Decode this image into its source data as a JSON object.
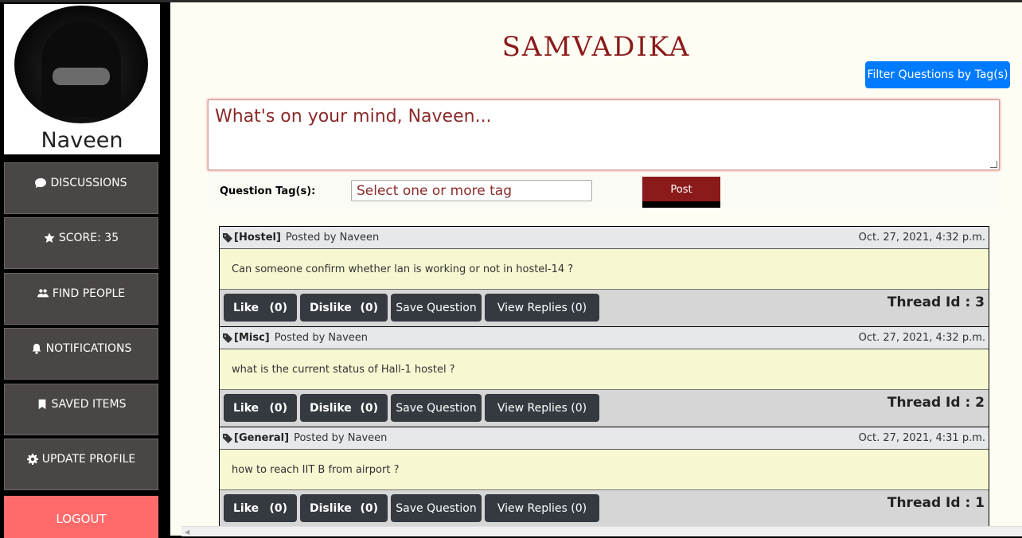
{
  "app": {
    "title": "SAMVADIKA"
  },
  "user": {
    "name": "Naveen"
  },
  "sidebar": {
    "items": [
      {
        "label": "DISCUSSIONS",
        "icon": "comment-icon"
      },
      {
        "label": "SCORE: 35",
        "icon": "star-icon"
      },
      {
        "label": "FIND PEOPLE",
        "icon": "users-icon"
      },
      {
        "label": "NOTIFICATIONS",
        "icon": "bell-icon"
      },
      {
        "label": "SAVED ITEMS",
        "icon": "bookmark-icon"
      },
      {
        "label": "UPDATE PROFILE",
        "icon": "gear-icon"
      }
    ],
    "logout_label": "LOGOUT"
  },
  "header": {
    "filter_label": "Filter Questions by Tag(s)"
  },
  "composer": {
    "placeholder": "What's on your mind, Naveen...",
    "tag_label": "Question Tag(s):",
    "tag_placeholder": "Select one or more tag",
    "post_label": "Post"
  },
  "posts": [
    {
      "tag": "[Hostel]",
      "posted_by": "Posted by Naveen",
      "date": "Oct. 27, 2021, 4:32 p.m.",
      "body": "Can someone confirm whether lan is working or not in hostel-14 ?",
      "like_label": "Like",
      "like_count": "(0)",
      "dislike_label": "Dislike",
      "dislike_count": "(0)",
      "save_label": "Save Question",
      "replies_label": "View Replies (0)",
      "thread": "Thread Id : 3"
    },
    {
      "tag": "[Misc]",
      "posted_by": "Posted by Naveen",
      "date": "Oct. 27, 2021, 4:32 p.m.",
      "body": "what is the current status of Hall-1 hostel ?",
      "like_label": "Like",
      "like_count": "(0)",
      "dislike_label": "Dislike",
      "dislike_count": "(0)",
      "save_label": "Save Question",
      "replies_label": "View Replies (0)",
      "thread": "Thread Id : 2"
    },
    {
      "tag": "[General]",
      "posted_by": "Posted by Naveen",
      "date": "Oct. 27, 2021, 4:31 p.m.",
      "body": "how to reach IIT B from airport ?",
      "like_label": "Like",
      "like_count": "(0)",
      "dislike_label": "Dislike",
      "dislike_count": "(0)",
      "save_label": "Save Question",
      "replies_label": "View Replies (0)",
      "thread": "Thread Id : 1"
    }
  ],
  "colors": {
    "brand": "#8b1a1a",
    "accent": "#007bff",
    "logout": "#ff6b6b",
    "nav": "#4a4645",
    "button": "#343a40"
  }
}
